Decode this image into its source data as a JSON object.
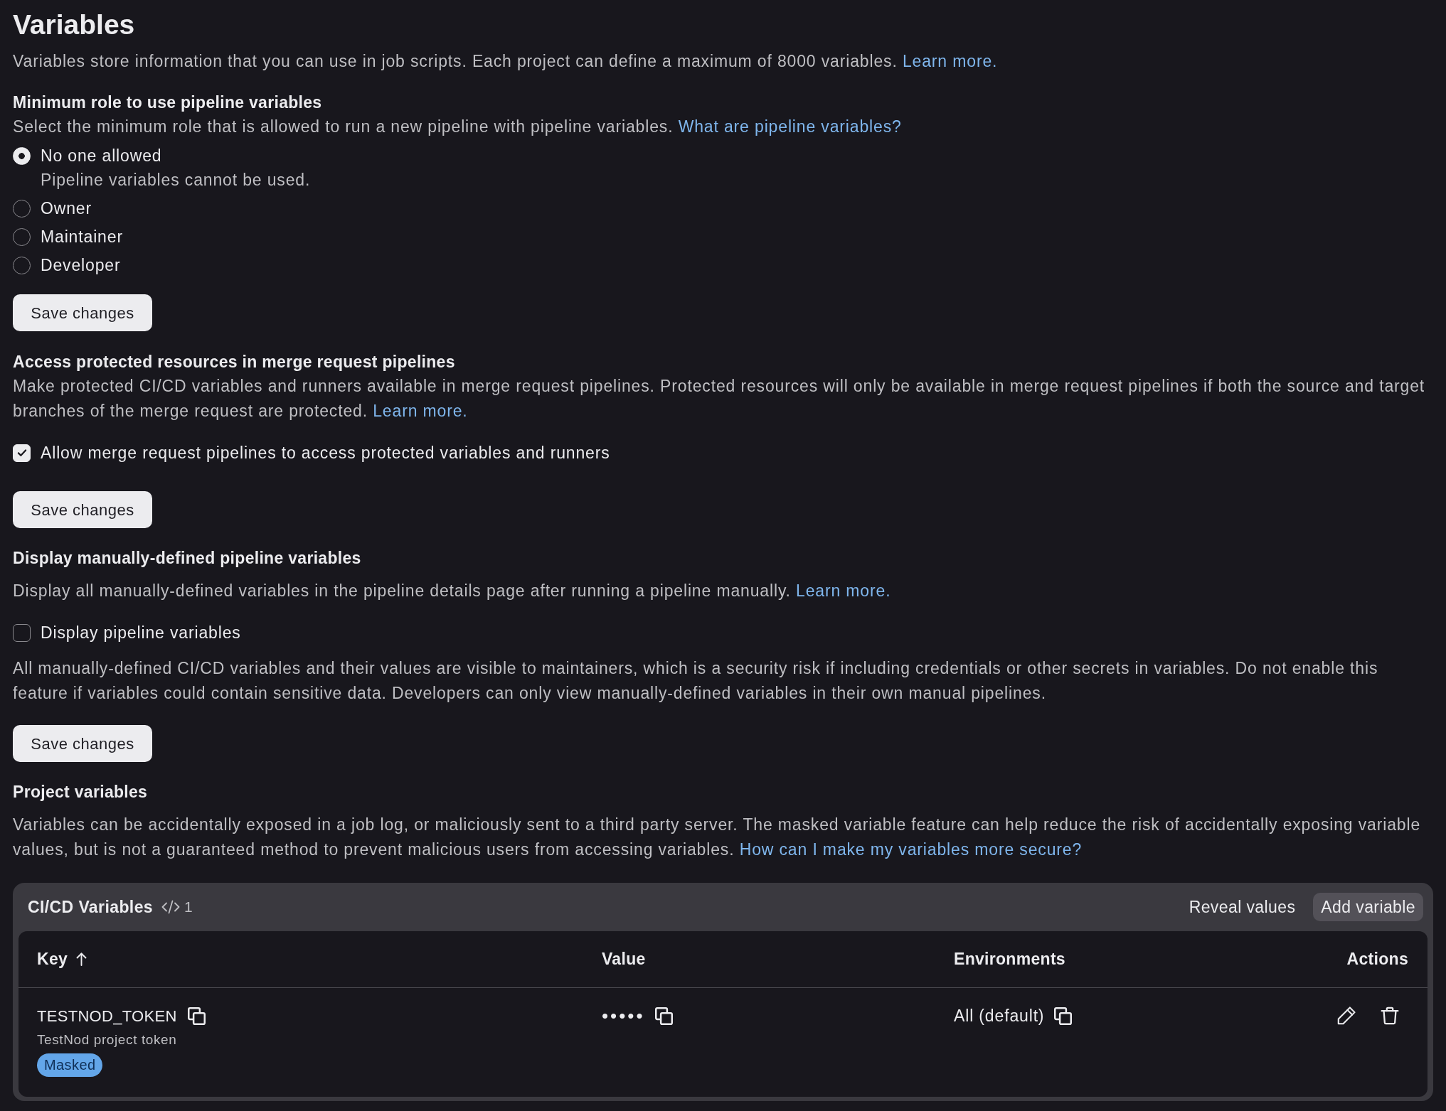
{
  "page": {
    "title": "Variables",
    "description": "Variables store information that you can use in job scripts. Each project can define a maximum of 8000 variables.",
    "link": "Learn more."
  },
  "sections": [
    {
      "kind": "radio_group",
      "heading": "Minimum role to use pipeline variables",
      "description": "Select the minimum role that is allowed to run a new pipeline with pipeline variables.",
      "link": "What are pipeline variables?",
      "options": [
        {
          "label": "No one allowed",
          "help": "Pipeline variables cannot be used.",
          "selected": true
        },
        {
          "label": "Owner",
          "selected": false
        },
        {
          "label": "Maintainer",
          "selected": false
        },
        {
          "label": "Developer",
          "selected": false
        }
      ],
      "button": "Save changes"
    },
    {
      "kind": "checkbox",
      "heading": "Access protected resources in merge request pipelines",
      "description": "Make protected CI/CD variables and runners available in merge request pipelines. Protected resources will only be available in merge request pipelines if both the source and target branches of the merge request are protected.",
      "link": "Learn more.",
      "checkbox": {
        "label": "Allow merge request pipelines to access protected variables and runners",
        "checked": true
      },
      "button": "Save changes"
    },
    {
      "kind": "checkbox",
      "heading": "Display manually-defined pipeline variables",
      "description": "Display all manually-defined variables in the pipeline details page after running a pipeline manually.",
      "link": "Learn more.",
      "checkbox": {
        "label": "Display pipeline variables",
        "checked": false
      },
      "note": "All manually-defined CI/CD variables and their values are visible to maintainers, which is a security risk if including credentials or other secrets in variables. Do not enable this feature if variables could contain sensitive data. Developers can only view manually-defined variables in their own manual pipelines.",
      "button": "Save changes"
    },
    {
      "kind": "text",
      "heading": "Project variables",
      "description": "Variables can be accidentally exposed in a job log, or maliciously sent to a third party server. The masked variable feature can help reduce the risk of accidentally exposing variable values, but is not a guaranteed method to prevent malicious users from accessing variables.",
      "link": "How can I make my variables more secure?"
    }
  ],
  "variables_card": {
    "title": "CI/CD Variables",
    "count": "1",
    "buttons": [
      {
        "label": "Reveal values",
        "kind": "tertiary"
      },
      {
        "label": "Add variable",
        "kind": "default"
      }
    ],
    "table": {
      "columns": [
        {
          "label": "Key",
          "sorted": true
        },
        {
          "label": "Value"
        },
        {
          "label": "Environments"
        },
        {
          "label": "Actions"
        }
      ],
      "rows": [
        {
          "key": "TESTNOD_TOKEN",
          "description": "TestNod project token",
          "badges": [
            "Masked"
          ],
          "value": "•••••",
          "environments": "All (default)"
        }
      ]
    }
  }
}
